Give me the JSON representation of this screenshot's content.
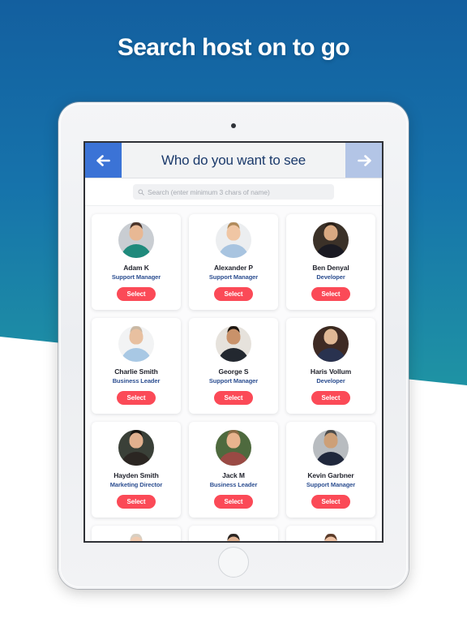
{
  "headline": "Search host on to go",
  "device": {
    "camera_icon": "camera-dot",
    "home_button_icon": "home-button"
  },
  "appbar": {
    "back_icon": "arrow-left-icon",
    "forward_icon": "arrow-right-icon",
    "title": "Who do you want to see",
    "back_color": "#3b73d6",
    "forward_color": "#b3c5e6",
    "title_color": "#1b3a6b"
  },
  "search": {
    "icon": "search-icon",
    "placeholder": "Search (enter minimum 3 chars of name)",
    "value": ""
  },
  "colors": {
    "bg_top": "#135f9f",
    "bg_bottom": "#2aa79a",
    "select_button": "#fb4a57",
    "role_text": "#2d4f91",
    "name_text": "#22242e"
  },
  "select_label": "Select",
  "people": [
    {
      "name": "Adam K",
      "role": "Support Manager",
      "hair": "#4a342a",
      "skin": "#e8b894",
      "cloth": "#1f8a7c",
      "bg": "#c9cdd2"
    },
    {
      "name": "Alexander P",
      "role": "Support Manager",
      "hair": "#b08a5a",
      "skin": "#f0c6a4",
      "cloth": "#a8c4e0",
      "bg": "#eceef0"
    },
    {
      "name": "Ben Denyal",
      "role": "Developer",
      "hair": "#2a2018",
      "skin": "#d9a982",
      "cloth": "#1a1a22",
      "bg": "#3b3128"
    },
    {
      "name": "Charlie Smith",
      "role": "Business Leader",
      "hair": "#c9b8a4",
      "skin": "#e8c0a0",
      "cloth": "#a8c8e4",
      "bg": "#f2f3f4"
    },
    {
      "name": "George S",
      "role": "Support Manager",
      "hair": "#1c150f",
      "skin": "#c9926a",
      "cloth": "#232830",
      "bg": "#e6e2dc"
    },
    {
      "name": "Haris Vollum",
      "role": "Developer",
      "hair": "#3a2a1e",
      "skin": "#e0b896",
      "cloth": "#29324f",
      "bg": "#3e2a24"
    },
    {
      "name": "Hayden Smith",
      "role": "Marketing Director",
      "hair": "#1a1410",
      "skin": "#e2b08e",
      "cloth": "#2b2622",
      "bg": "#3a4038"
    },
    {
      "name": "Jack M",
      "role": "Business Leader",
      "hair": "#8a6a44",
      "skin": "#e8b48e",
      "cloth": "#9a4a44",
      "bg": "#4e6a3e"
    },
    {
      "name": "Kevin Garbner",
      "role": "Support Manager",
      "hair": "#4a4a4a",
      "skin": "#cda078",
      "cloth": "#20283c",
      "bg": "#b8bcc0"
    }
  ],
  "people_partial": [
    {
      "name": "",
      "role": "",
      "hair": "#d8cfc2",
      "skin": "#f0cbb0",
      "cloth": "#e8e4e0",
      "bg": "#ffffff"
    },
    {
      "name": "",
      "role": "",
      "hair": "#2a2420",
      "skin": "#e0b292",
      "cloth": "#caa89a",
      "bg": "#ffffff"
    },
    {
      "name": "",
      "role": "",
      "hair": "#5a3a28",
      "skin": "#eec2a4",
      "cloth": "#cfe4e8",
      "bg": "#ffffff"
    }
  ]
}
